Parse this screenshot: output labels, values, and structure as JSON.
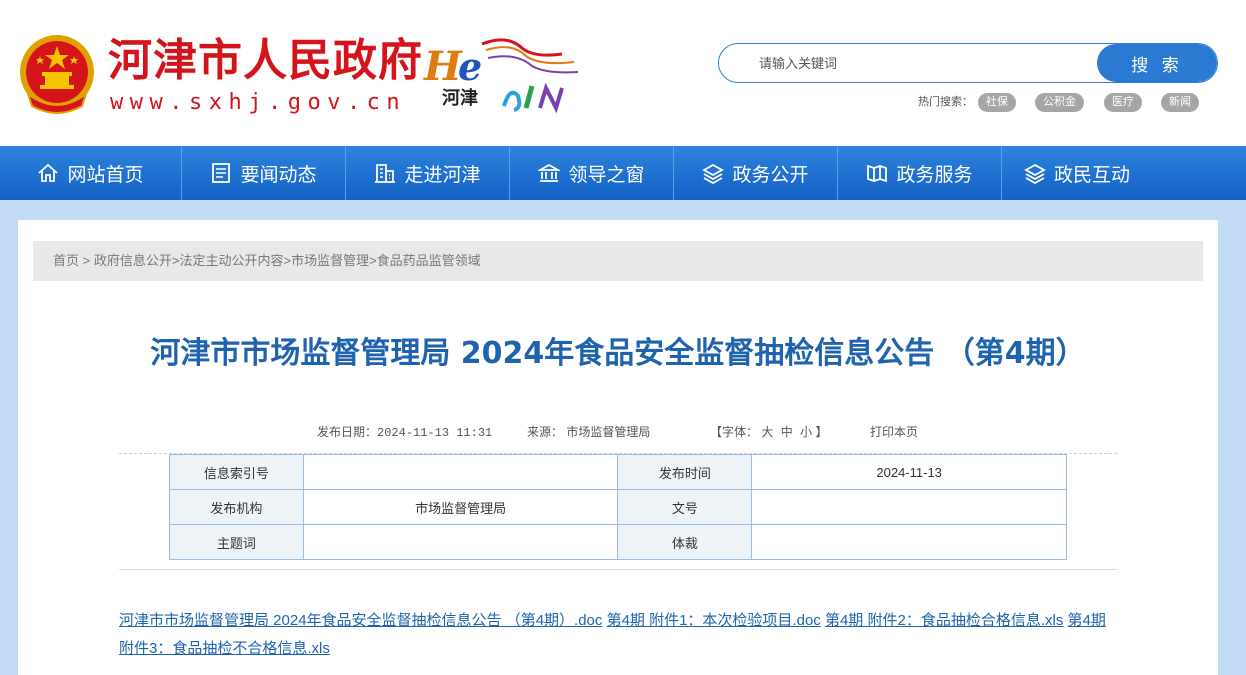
{
  "header": {
    "site_name": "河津市人民政府",
    "site_url": "www.sxhj.gov.cn",
    "logo_text": "河津",
    "logo_letters": "He JIN"
  },
  "search": {
    "placeholder": "请输入关键词",
    "button_label": "搜 索"
  },
  "hot_search": {
    "label": "热门搜索：",
    "tags": [
      "社保",
      "公积金",
      "医疗",
      "新闻"
    ]
  },
  "nav": {
    "items": [
      {
        "label": "网站首页",
        "icon": "home-icon"
      },
      {
        "label": "要闻动态",
        "icon": "news-icon"
      },
      {
        "label": "走进河津",
        "icon": "building-icon"
      },
      {
        "label": "领导之窗",
        "icon": "hall-icon"
      },
      {
        "label": "政务公开",
        "icon": "layers-icon"
      },
      {
        "label": "政务服务",
        "icon": "book-icon"
      },
      {
        "label": "政民互动",
        "icon": "layers-icon"
      }
    ]
  },
  "breadcrumb": {
    "items": [
      "首页",
      "政府信息公开",
      "法定主动公开内容",
      "市场监督管理",
      "食品药品监管领域"
    ],
    "sep_first": " > ",
    "sep": ">"
  },
  "article": {
    "title": "河津市市场监督管理局 2024年食品安全监督抽检信息公告 （第4期）",
    "publish_label": "发布日期：",
    "publish_value": "2024-11-13 11:31",
    "source_label": "来源：",
    "source_value": "市场监督管理局",
    "font_label": "【字体：",
    "font_large": "大",
    "font_medium": "中",
    "font_small": "小",
    "font_end": "】",
    "print_label": "打印本页"
  },
  "info_table": {
    "rows": [
      [
        {
          "label": "信息索引号",
          "value": ""
        },
        {
          "label": "发布时间",
          "value": "2024-11-13"
        }
      ],
      [
        {
          "label": "发布机构",
          "value": "市场监督管理局"
        },
        {
          "label": "文号",
          "value": ""
        }
      ],
      [
        {
          "label": "主题词",
          "value": ""
        },
        {
          "label": "体裁",
          "value": ""
        }
      ]
    ]
  },
  "attachments": [
    "河津市市场监督管理局 2024年食品安全监督抽检信息公告 （第4期）.doc",
    "第4期 附件1：本次检验项目.doc",
    "第4期 附件2：食品抽检合格信息.xls",
    "第4期 附件3：食品抽检不合格信息.xls"
  ],
  "colors": {
    "brand_red": "#d4141a",
    "nav_blue": "#1f6fd0",
    "title_blue": "#1f63ae",
    "page_bg": "#c3dcf5"
  }
}
